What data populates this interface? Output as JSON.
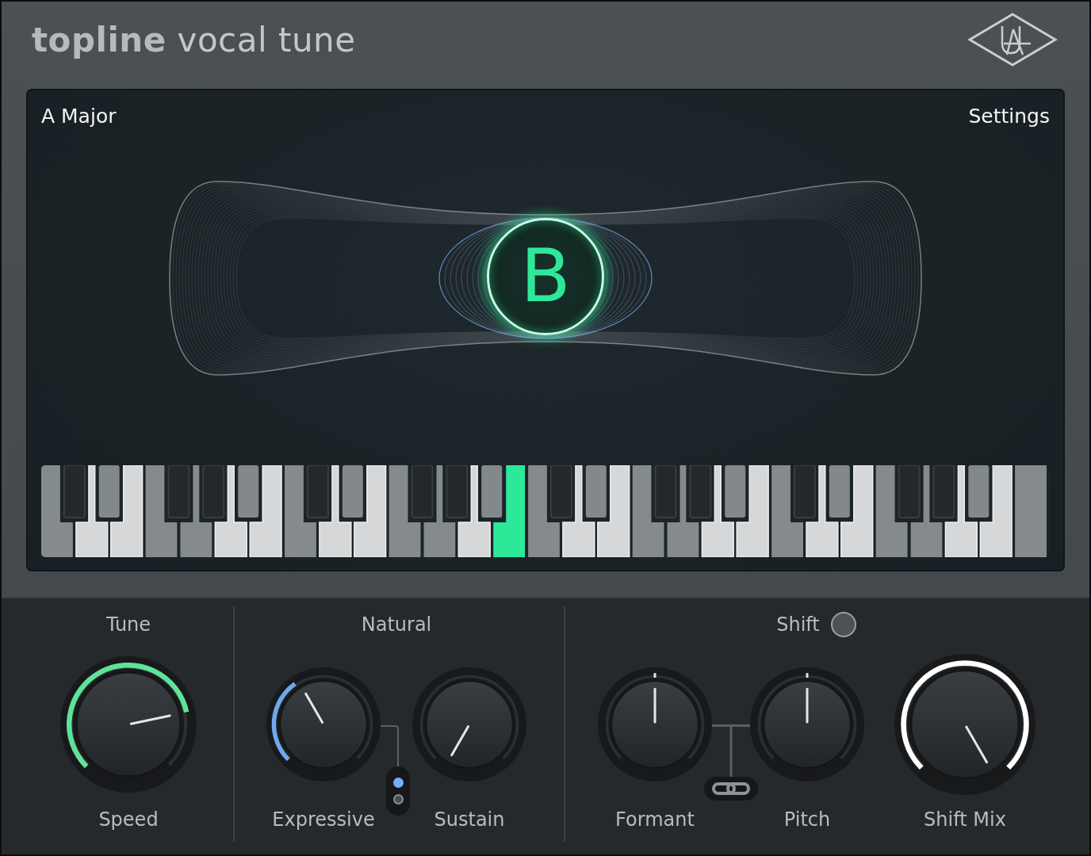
{
  "header": {
    "title": "**topline** vocal tune"
  },
  "display": {
    "key": "A Major",
    "settings": "Settings",
    "note": "B",
    "keys": [
      {
        "kind": "white",
        "in_scale": false,
        "selected": false
      },
      {
        "kind": "black",
        "in_scale": true,
        "selected": false
      },
      {
        "kind": "white",
        "in_scale": true,
        "selected": false
      },
      {
        "kind": "black",
        "in_scale": false,
        "selected": false
      },
      {
        "kind": "white",
        "in_scale": true,
        "selected": false
      },
      {
        "kind": "white",
        "in_scale": false,
        "selected": false
      },
      {
        "kind": "black",
        "in_scale": true,
        "selected": false
      },
      {
        "kind": "white",
        "in_scale": false,
        "selected": false
      },
      {
        "kind": "black",
        "in_scale": true,
        "selected": false
      },
      {
        "kind": "white",
        "in_scale": true,
        "selected": false
      },
      {
        "kind": "black",
        "in_scale": false,
        "selected": false
      },
      {
        "kind": "white",
        "in_scale": true,
        "selected": false
      },
      {
        "kind": "white",
        "in_scale": false,
        "selected": false
      },
      {
        "kind": "black",
        "in_scale": true,
        "selected": false
      },
      {
        "kind": "white",
        "in_scale": true,
        "selected": false
      },
      {
        "kind": "black",
        "in_scale": false,
        "selected": false
      },
      {
        "kind": "white",
        "in_scale": true,
        "selected": false
      },
      {
        "kind": "white",
        "in_scale": false,
        "selected": false
      },
      {
        "kind": "black",
        "in_scale": true,
        "selected": false
      },
      {
        "kind": "white",
        "in_scale": false,
        "selected": false
      },
      {
        "kind": "black",
        "in_scale": true,
        "selected": false
      },
      {
        "kind": "white",
        "in_scale": true,
        "selected": false
      },
      {
        "kind": "black",
        "in_scale": false,
        "selected": false
      },
      {
        "kind": "white",
        "in_scale": true,
        "selected": true
      },
      {
        "kind": "white",
        "in_scale": false,
        "selected": false
      },
      {
        "kind": "black",
        "in_scale": true,
        "selected": false
      },
      {
        "kind": "white",
        "in_scale": true,
        "selected": false
      },
      {
        "kind": "black",
        "in_scale": false,
        "selected": false
      },
      {
        "kind": "white",
        "in_scale": true,
        "selected": false
      },
      {
        "kind": "white",
        "in_scale": false,
        "selected": false
      },
      {
        "kind": "black",
        "in_scale": true,
        "selected": false
      },
      {
        "kind": "white",
        "in_scale": false,
        "selected": false
      },
      {
        "kind": "black",
        "in_scale": true,
        "selected": false
      },
      {
        "kind": "white",
        "in_scale": true,
        "selected": false
      },
      {
        "kind": "black",
        "in_scale": false,
        "selected": false
      },
      {
        "kind": "white",
        "in_scale": true,
        "selected": false
      },
      {
        "kind": "white",
        "in_scale": false,
        "selected": false
      },
      {
        "kind": "black",
        "in_scale": true,
        "selected": false
      },
      {
        "kind": "white",
        "in_scale": true,
        "selected": false
      },
      {
        "kind": "black",
        "in_scale": false,
        "selected": false
      },
      {
        "kind": "white",
        "in_scale": true,
        "selected": false
      },
      {
        "kind": "white",
        "in_scale": false,
        "selected": false
      },
      {
        "kind": "black",
        "in_scale": true,
        "selected": false
      },
      {
        "kind": "white",
        "in_scale": false,
        "selected": false
      },
      {
        "kind": "black",
        "in_scale": true,
        "selected": false
      },
      {
        "kind": "white",
        "in_scale": true,
        "selected": false
      },
      {
        "kind": "black",
        "in_scale": false,
        "selected": false
      },
      {
        "kind": "white",
        "in_scale": true,
        "selected": false
      },
      {
        "kind": "white",
        "in_scale": false,
        "selected": false
      }
    ]
  },
  "sections": [
    {
      "kind": "tune",
      "title": "Tune",
      "knobs": [
        {
          "label": "Speed",
          "kind": "unipolar",
          "color": "#5fe39a"
        }
      ]
    },
    {
      "kind": "natural",
      "title": "Natural",
      "knobs": [
        {
          "label": "Expressive",
          "kind": "unipolar",
          "color": "#6fa8f0"
        },
        {
          "label": "Sustain",
          "kind": "unipolar"
        }
      ],
      "mode_switch": {
        "options": [
          {
            "selected": true
          },
          {
            "selected": false
          }
        ]
      }
    },
    {
      "kind": "shift",
      "title": "Shift",
      "enabled": false,
      "knobs": [
        {
          "label": "Formant",
          "kind": "bipolar"
        },
        {
          "label": "Pitch",
          "kind": "bipolar"
        },
        {
          "label": "Shift Mix",
          "kind": "unipolar",
          "color": "#ffffff"
        }
      ]
    }
  ]
}
